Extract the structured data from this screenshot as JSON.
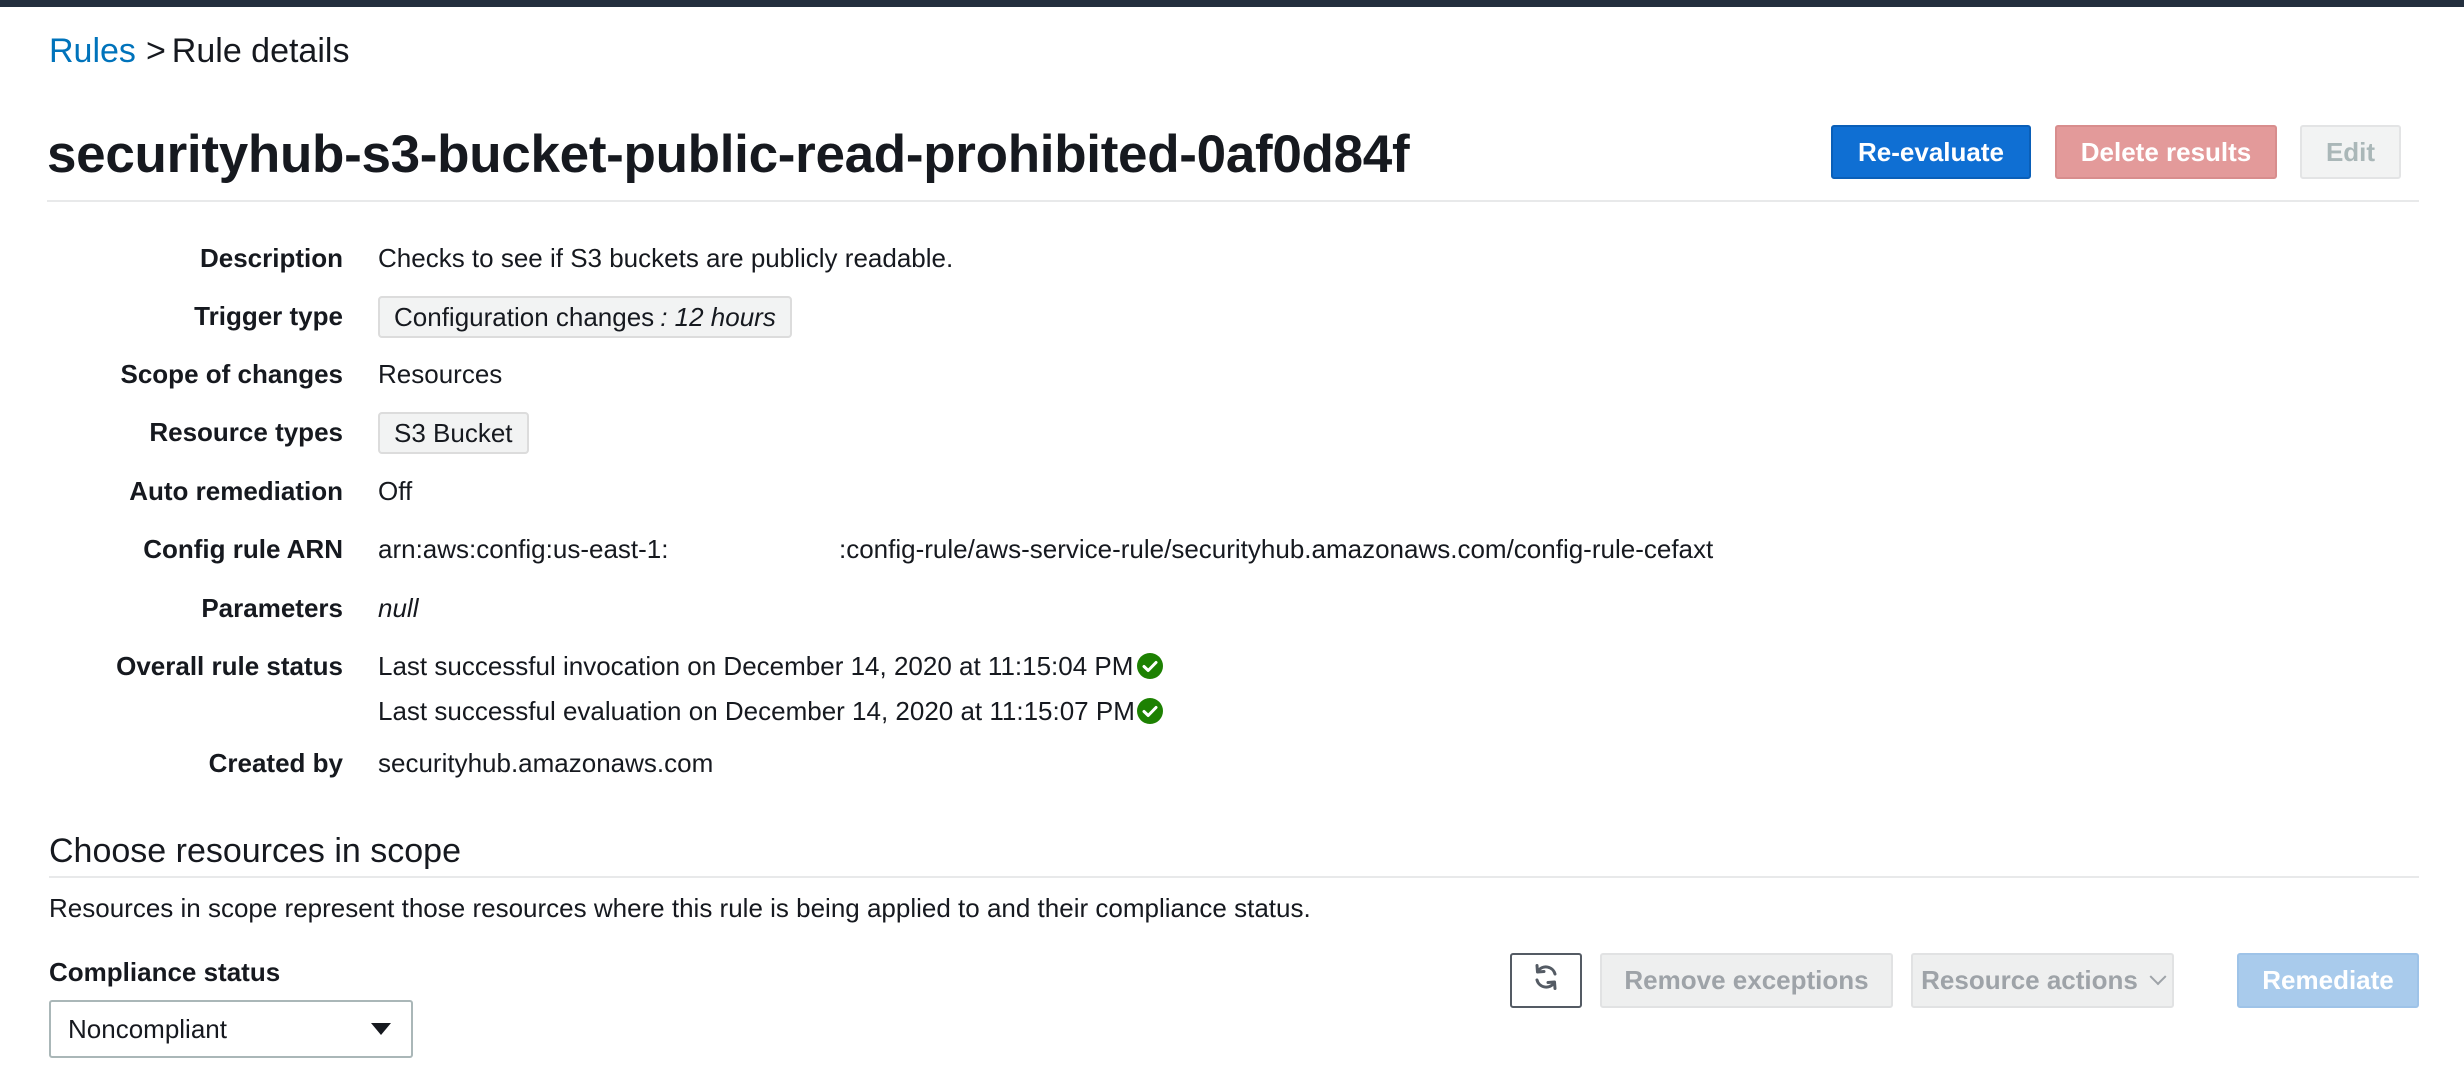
{
  "breadcrumb": {
    "root": "Rules",
    "separator": ">",
    "current": "Rule details"
  },
  "page": {
    "title": "securityhub-s3-bucket-public-read-prohibited-0af0d84f"
  },
  "header_actions": {
    "reevaluate": "Re-evaluate",
    "delete_results": "Delete results",
    "edit": "Edit"
  },
  "details": {
    "description_label": "Description",
    "description_value": "Checks to see if S3 buckets are publicly readable.",
    "trigger_label": "Trigger type",
    "trigger_value": "Configuration changes",
    "trigger_suffix": ": 12 hours",
    "scope_label": "Scope of changes",
    "scope_value": "Resources",
    "resource_types_label": "Resource types",
    "resource_types_value": "S3 Bucket",
    "auto_remediation_label": "Auto remediation",
    "auto_remediation_value": "Off",
    "arn_label": "Config rule ARN",
    "arn_prefix": "arn:aws:config:us-east-1:",
    "arn_suffix": ":config-rule/aws-service-rule/securityhub.amazonaws.com/config-rule-cefaxt",
    "parameters_label": "Parameters",
    "parameters_value": "null",
    "status_label": "Overall rule status",
    "status_invocation": "Last successful invocation on December 14, 2020 at 11:15:04 PM",
    "status_evaluation": "Last successful evaluation on December 14, 2020 at 11:15:07 PM",
    "created_by_label": "Created by",
    "created_by_value": "securityhub.amazonaws.com"
  },
  "scope_section": {
    "title": "Choose resources in scope",
    "description": "Resources in scope represent those resources where this rule is being applied to and their compliance status.",
    "compliance_label": "Compliance status",
    "compliance_selected": "Noncompliant",
    "remove_exceptions": "Remove exceptions",
    "resource_actions": "Resource actions",
    "remediate": "Remediate"
  },
  "icons": {
    "refresh": "refresh-icon",
    "success": "check-circle-icon",
    "dropdown": "caret-down-icon"
  },
  "colors": {
    "link": "#0073bb",
    "primary": "#0f6fd3",
    "success": "#1d8102",
    "topbar": "#232f3e"
  }
}
